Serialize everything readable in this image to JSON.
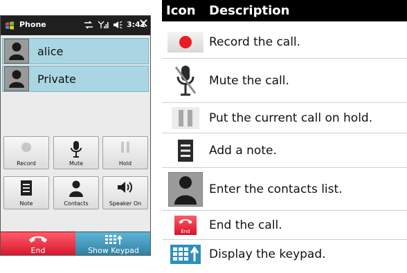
{
  "phone": {
    "status_bar": {
      "app_title": "Phone",
      "time": "3:41",
      "close_glyph": "✕"
    },
    "callers": [
      {
        "name": "alice",
        "icon": "contact-avatar-icon"
      },
      {
        "name": "Private",
        "icon": "contact-avatar-icon"
      }
    ],
    "controls": [
      {
        "label": "Record",
        "icon": "record-icon",
        "enabled": false
      },
      {
        "label": "Mute",
        "icon": "microphone-icon",
        "enabled": true
      },
      {
        "label": "Hold",
        "icon": "pause-icon",
        "enabled": false
      },
      {
        "label": "Note",
        "icon": "note-icon",
        "enabled": true
      },
      {
        "label": "Contacts",
        "icon": "contact-icon",
        "enabled": true
      },
      {
        "label": "Speaker On",
        "icon": "speaker-icon",
        "enabled": true
      }
    ],
    "bottom_bar": {
      "end_label": "End",
      "keypad_label": "Show Keypad",
      "end_color": "#e11d35",
      "keypad_color": "#3b93b8"
    }
  },
  "legend": {
    "header": {
      "icon_col": "Icon",
      "desc_col": "Description"
    },
    "rows": [
      {
        "icon": "record-icon",
        "description": "Record the call."
      },
      {
        "icon": "mute-microphone-icon",
        "description": "Mute the call."
      },
      {
        "icon": "hold-icon",
        "description": "Put the current call on hold."
      },
      {
        "icon": "note-icon",
        "description": "Add a note."
      },
      {
        "icon": "contacts-icon",
        "description": "Enter the contacts list."
      },
      {
        "icon": "end-call-icon",
        "description": "End the call.",
        "icon_text": "End"
      },
      {
        "icon": "keypad-icon",
        "description": "Display the keypad."
      }
    ]
  }
}
